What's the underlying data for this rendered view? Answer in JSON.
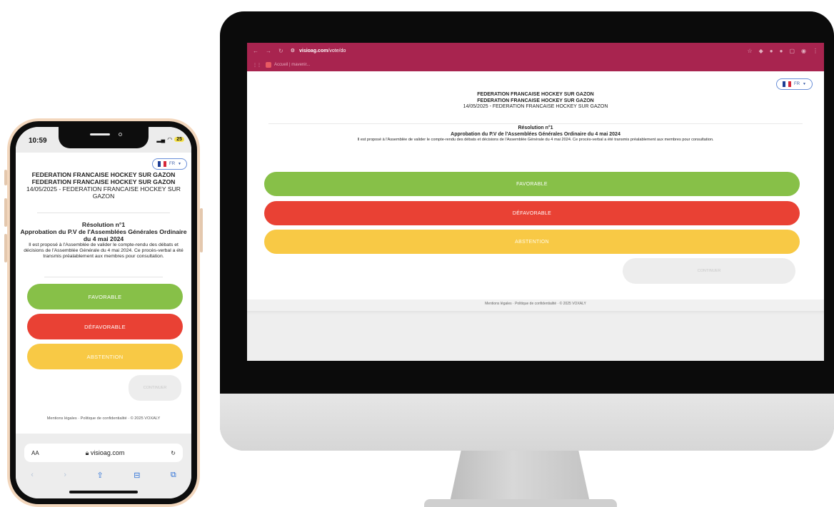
{
  "desktop": {
    "browser": {
      "url": "visioag.com/vote/do",
      "url_host": "visioag.com",
      "url_path": "/vote/do",
      "bookmark": "Accueil | mavenir..."
    },
    "lang": "FR",
    "header": {
      "line1": "FEDERATION FRANCAISE HOCKEY SUR GAZON",
      "line2": "FEDERATION FRANCAISE HOCKEY SUR GAZON",
      "line3": "14/05/2025 - FEDERATION FRANCAISE HOCKEY SUR GAZON"
    },
    "resolution": {
      "number": "Résolution n°1",
      "title": "Approbation du P.V de l'Assemblées Générales Ordinaire du 4 mai 2024",
      "description": "Il est proposé à l'Assemblée de valider le compte-rendu des débats et décisions de l'Assemblée Générale du 4 mai 2024. Ce procès-verbal a été transmis préalablement aux membres pour consultation."
    },
    "buttons": {
      "favorable": "FAVORABLE",
      "defavorable": "DÉFAVORABLE",
      "abstention": "ABSTENTION",
      "continuer": "CONTINUER"
    },
    "footer": "Mentions légales · Politique de confidentialité · © 2025 VOXALY"
  },
  "phone": {
    "status": {
      "time": "10:59",
      "battery": "25"
    },
    "lang": "FR",
    "header": {
      "line1": "FEDERATION FRANCAISE HOCKEY SUR GAZON",
      "line2": "FEDERATION FRANCAISE HOCKEY SUR GAZON",
      "line3": "14/05/2025 - FEDERATION FRANCAISE HOCKEY SUR GAZON"
    },
    "resolution": {
      "number": "Résolution n°1",
      "title": "Approbation du P.V de l'Assemblées Générales Ordinaire du 4 mai 2024",
      "description": "Il est proposé à l'Assemblée de valider le compte-rendu des débats et décisions de l'Assemblée Générale du 4 mai 2024. Ce procès-verbal a été transmis préalablement aux membres pour consultation."
    },
    "buttons": {
      "favorable": "FAVORABLE",
      "defavorable": "DÉFAVORABLE",
      "abstention": "ABSTENTION",
      "continuer": "CONTINUER"
    },
    "footer": "Mentions légales · Politique de confidentialité · © 2025 VOXALY",
    "safari": {
      "text_size": "AA",
      "domain": "visioag.com"
    }
  },
  "colors": {
    "favorable": "#87c048",
    "defavorable": "#e94134",
    "abstention": "#f8c945",
    "continuer": "#ededed",
    "browser_chrome": "#a8244f"
  },
  "icons": {
    "lang_flag": "france-flag-icon",
    "lang_caret": "chevron-down-icon",
    "reload": "reload-icon",
    "lock": "lock-icon",
    "share": "share-icon",
    "bookmarks": "book-icon",
    "tabs": "tabs-icon"
  }
}
